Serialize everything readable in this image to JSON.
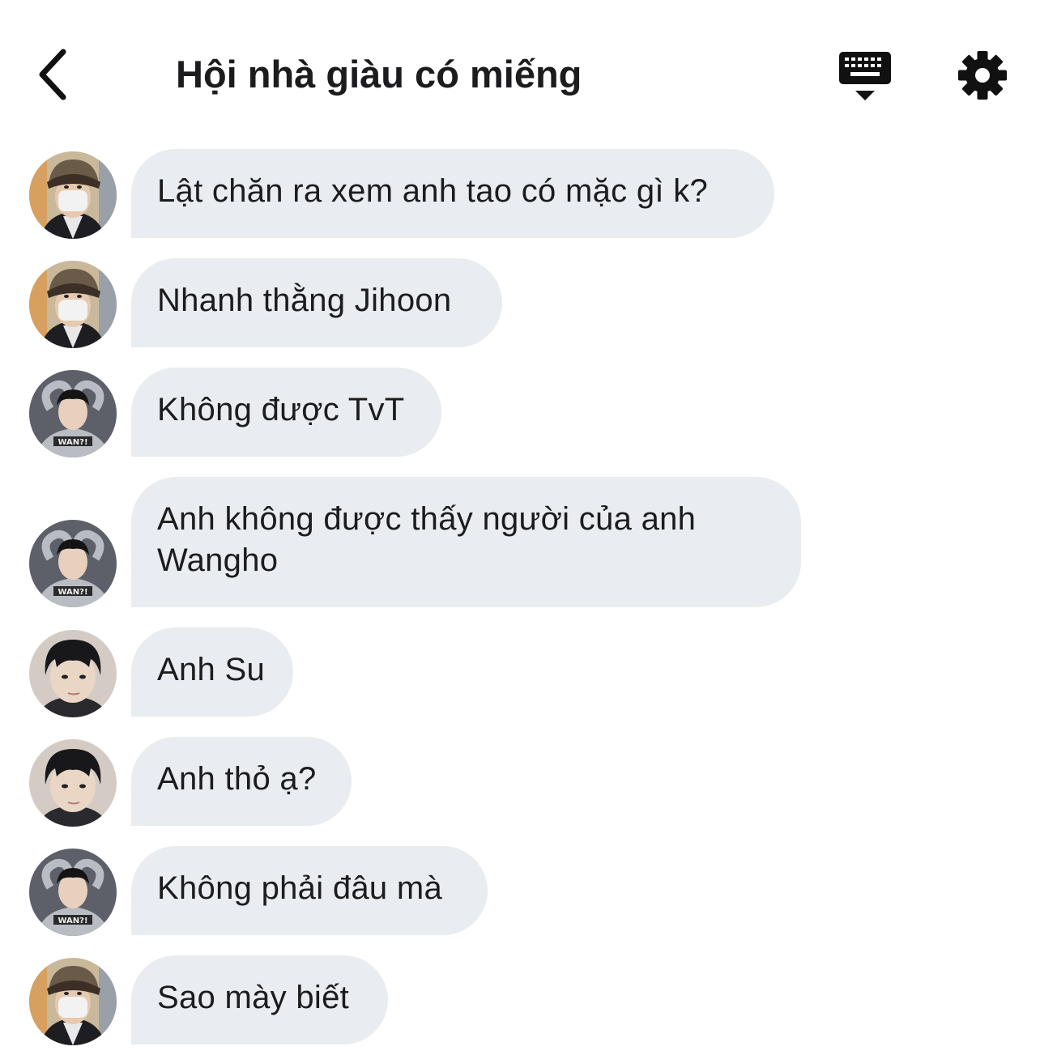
{
  "header": {
    "title": "Hội nhà giàu có miếng",
    "back_icon": "chevron-left-icon",
    "keyboard_icon": "keyboard-icon",
    "settings_icon": "gear-icon"
  },
  "colors": {
    "bubble": "#e9ecf0",
    "text": "#1c1c1e",
    "icon": "#111111"
  },
  "messages": [
    {
      "sender_avatar": "avatar-fur-hat-mask",
      "text": "Lật chăn ra xem anh tao có mặc gì k?"
    },
    {
      "sender_avatar": "avatar-fur-hat-mask",
      "text": "Nhanh thằng Jihoon"
    },
    {
      "sender_avatar": "avatar-heart-hands",
      "text": "Không được TvT"
    },
    {
      "sender_avatar": "avatar-heart-hands",
      "text": "Anh không được thấy người của anh Wangho"
    },
    {
      "sender_avatar": "avatar-child-bangs",
      "text": "Anh Su"
    },
    {
      "sender_avatar": "avatar-child-bangs",
      "text": "Anh thỏ ạ?"
    },
    {
      "sender_avatar": "avatar-heart-hands",
      "text": "Không phải đâu mà"
    },
    {
      "sender_avatar": "avatar-fur-hat-mask",
      "text": "Sao mày biết"
    }
  ]
}
